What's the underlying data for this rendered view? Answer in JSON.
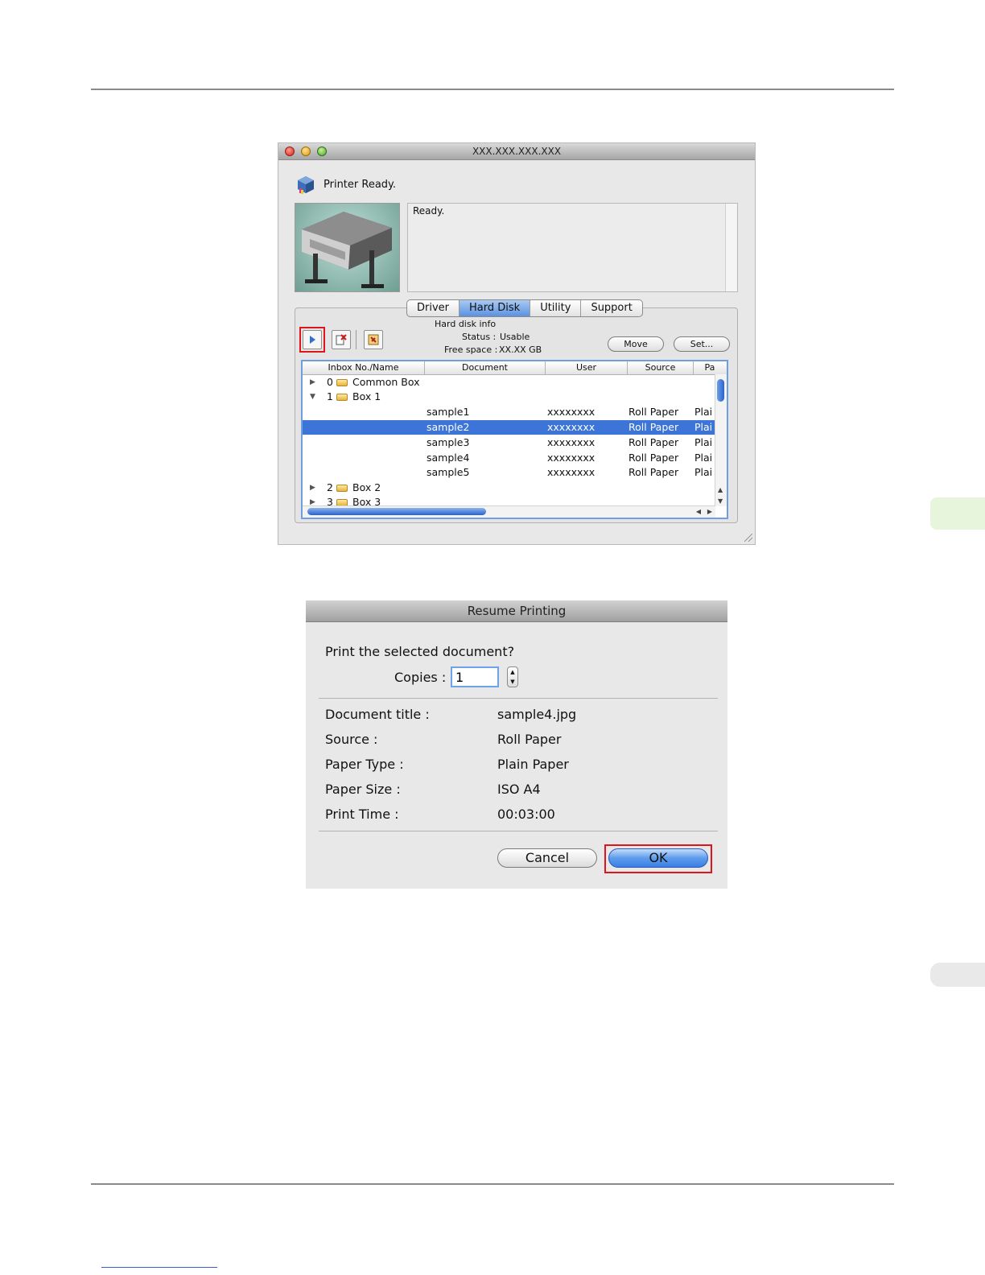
{
  "monitor": {
    "window_title": "XXX.XXX.XXX.XXX",
    "status": "Printer Ready.",
    "message": "Ready.",
    "tabs": [
      {
        "label": "Driver",
        "active": false
      },
      {
        "label": "Hard Disk",
        "active": true
      },
      {
        "label": "Utility",
        "active": false
      },
      {
        "label": "Support",
        "active": false
      }
    ],
    "hard_disk": {
      "heading": "Hard disk info",
      "status_label": "Status :",
      "status_value": "Usable",
      "free_label": "Free space :",
      "free_value": "XX.XX GB"
    },
    "buttons": {
      "move": "Move",
      "set": "Set..."
    },
    "columns": [
      "Inbox No./Name",
      "Document",
      "User",
      "Source",
      "Pa"
    ],
    "boxes": [
      {
        "no": "0",
        "name": "Common Box",
        "expanded": false
      },
      {
        "no": "1",
        "name": "Box 1",
        "expanded": true
      },
      {
        "no": "2",
        "name": "Box 2",
        "expanded": false
      },
      {
        "no": "3",
        "name": "Box 3",
        "expanded": false
      }
    ],
    "documents": [
      {
        "document": "sample1",
        "user": "xxxxxxxx",
        "source": "Roll Paper",
        "paper": "Plai",
        "selected": false
      },
      {
        "document": "sample2",
        "user": "xxxxxxxx",
        "source": "Roll Paper",
        "paper": "Plai",
        "selected": true
      },
      {
        "document": "sample3",
        "user": "xxxxxxxx",
        "source": "Roll Paper",
        "paper": "Plai",
        "selected": false
      },
      {
        "document": "sample4",
        "user": "xxxxxxxx",
        "source": "Roll Paper",
        "paper": "Plai",
        "selected": false
      },
      {
        "document": "sample5",
        "user": "xxxxxxxx",
        "source": "Roll Paper",
        "paper": "Plai",
        "selected": false
      }
    ]
  },
  "dialog": {
    "title": "Resume Printing",
    "question": "Print the selected document?",
    "copies_label": "Copies :",
    "copies_value": "1",
    "details": [
      {
        "label": "Document title :",
        "value": "sample4.jpg"
      },
      {
        "label": "Source :",
        "value": "Roll Paper"
      },
      {
        "label": "Paper Type :",
        "value": "Plain Paper"
      },
      {
        "label": "Paper Size :",
        "value": "ISO A4"
      },
      {
        "label": "Print Time :",
        "value": "00:03:00"
      }
    ],
    "cancel_label": "Cancel",
    "ok_label": "OK"
  },
  "colors": {
    "highlight": "#e0151b",
    "selection": "#3d74d7",
    "accent_tab": "#e6f5dc"
  }
}
